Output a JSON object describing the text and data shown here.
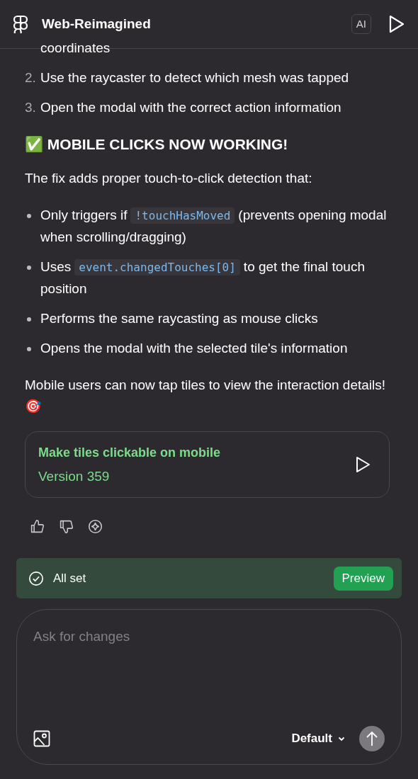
{
  "header": {
    "title": "Web-Reimagined",
    "ai_badge": "AI"
  },
  "steps": [
    {
      "text": "coordinates"
    },
    {
      "number": "2.",
      "text": "Use the raycaster to detect which mesh was tapped"
    },
    {
      "number": "3.",
      "text": "Open the modal with the correct action information"
    }
  ],
  "heading": "✅ MOBILE CLICKS NOW WORKING!",
  "intro": "The fix adds proper touch-to-click detection that:",
  "bullets": [
    {
      "parts": [
        {
          "kind": "text",
          "text": "Only triggers if"
        },
        {
          "kind": "code",
          "text": "!touchHasMoved"
        },
        {
          "kind": "text",
          "text": "(prevents opening modal when scrolling/dragging)"
        }
      ]
    },
    {
      "parts": [
        {
          "kind": "text",
          "text": "Uses"
        },
        {
          "kind": "code",
          "text": "event.changedTouches[0]"
        },
        {
          "kind": "text",
          "text": "to get the final touch position"
        }
      ]
    },
    {
      "parts": [
        {
          "kind": "text",
          "text": "Performs the same raycasting as mouse clicks"
        }
      ]
    },
    {
      "parts": [
        {
          "kind": "text",
          "text": "Opens the modal with the selected tile's information"
        }
      ]
    }
  ],
  "outro": "Mobile users can now tap tiles to view the interaction details! 🎯",
  "version_card": {
    "title": "Make tiles clickable on mobile",
    "version": "Version 359"
  },
  "status": {
    "label": "All set",
    "button": "Preview"
  },
  "composer": {
    "placeholder": "Ask for changes",
    "mode": "Default"
  }
}
